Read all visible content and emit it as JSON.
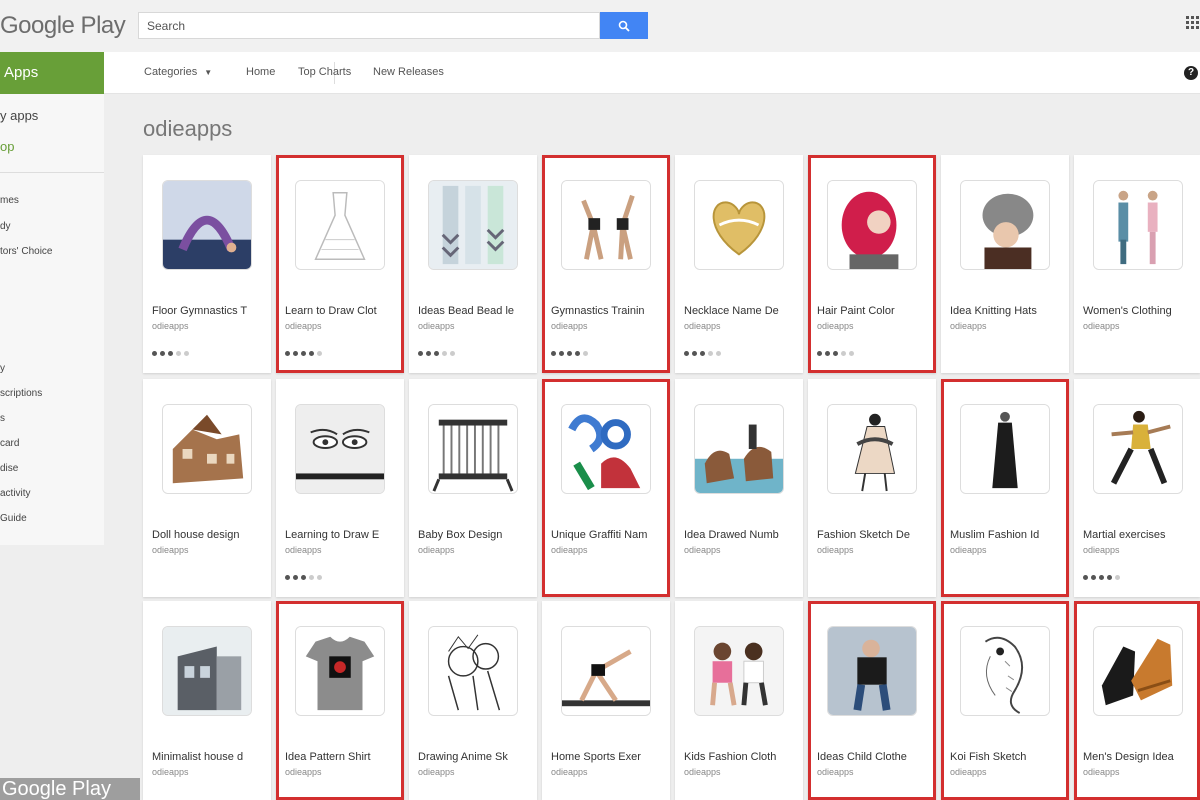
{
  "header": {
    "logo": "Google Play",
    "search_placeholder": "Search"
  },
  "sidebar": {
    "apps_tab": "Apps",
    "links": [
      "y apps",
      "op"
    ],
    "small_links_1": [
      "mes",
      "dy",
      "tors' Choice"
    ],
    "small_links_2": [
      "y",
      "scriptions",
      "s",
      "card",
      "dise",
      "activity",
      "Guide"
    ],
    "footer_logo": "Google Play"
  },
  "subnav": {
    "categories": "Categories",
    "home": "Home",
    "top_charts": "Top Charts",
    "new_releases": "New Releases",
    "help": "?"
  },
  "developer": "odieapps",
  "colors": {
    "accent_green": "#689f38",
    "search_blue": "#4285f4",
    "highlight_red": "#d32f2f"
  },
  "apps": [
    {
      "title": "Floor Gymnastics T",
      "dev": "odieapps",
      "rating": 3,
      "highlighted": false
    },
    {
      "title": "Learn to Draw Clot",
      "dev": "odieapps",
      "rating": 4,
      "highlighted": true
    },
    {
      "title": "Ideas Bead Bead le",
      "dev": "odieapps",
      "rating": 3,
      "highlighted": false
    },
    {
      "title": "Gymnastics Trainin",
      "dev": "odieapps",
      "rating": 4,
      "highlighted": true
    },
    {
      "title": "Necklace Name De",
      "dev": "odieapps",
      "rating": 3,
      "highlighted": false
    },
    {
      "title": "Hair Paint Color",
      "dev": "odieapps",
      "rating": 3,
      "highlighted": true
    },
    {
      "title": "Idea Knitting Hats",
      "dev": "odieapps",
      "rating": null,
      "highlighted": false
    },
    {
      "title": "Women's Clothing",
      "dev": "odieapps",
      "rating": null,
      "highlighted": false
    },
    {
      "title": "Doll house design",
      "dev": "odieapps",
      "rating": null,
      "highlighted": false
    },
    {
      "title": "Learning to Draw E",
      "dev": "odieapps",
      "rating": 3,
      "highlighted": false
    },
    {
      "title": "Baby Box Design",
      "dev": "odieapps",
      "rating": null,
      "highlighted": false
    },
    {
      "title": "Unique Graffiti Nam",
      "dev": "odieapps",
      "rating": null,
      "highlighted": true
    },
    {
      "title": "Idea Drawed Numb",
      "dev": "odieapps",
      "rating": null,
      "highlighted": false
    },
    {
      "title": "Fashion Sketch De",
      "dev": "odieapps",
      "rating": null,
      "highlighted": false
    },
    {
      "title": "Muslim Fashion Id",
      "dev": "odieapps",
      "rating": null,
      "highlighted": true
    },
    {
      "title": "Martial exercises",
      "dev": "odieapps",
      "rating": 4,
      "highlighted": false
    },
    {
      "title": "Minimalist house d",
      "dev": "odieapps",
      "rating": null,
      "highlighted": false
    },
    {
      "title": "Idea Pattern Shirt",
      "dev": "odieapps",
      "rating": null,
      "highlighted": true
    },
    {
      "title": "Drawing Anime Sk",
      "dev": "odieapps",
      "rating": null,
      "highlighted": false
    },
    {
      "title": "Home Sports Exer",
      "dev": "odieapps",
      "rating": null,
      "highlighted": false
    },
    {
      "title": "Kids Fashion Cloth",
      "dev": "odieapps",
      "rating": null,
      "highlighted": false
    },
    {
      "title": "Ideas Child Clothe",
      "dev": "odieapps",
      "rating": null,
      "highlighted": true
    },
    {
      "title": "Koi Fish Sketch",
      "dev": "odieapps",
      "rating": null,
      "highlighted": true
    },
    {
      "title": "Men's Design Idea",
      "dev": "odieapps",
      "rating": null,
      "highlighted": true
    }
  ]
}
